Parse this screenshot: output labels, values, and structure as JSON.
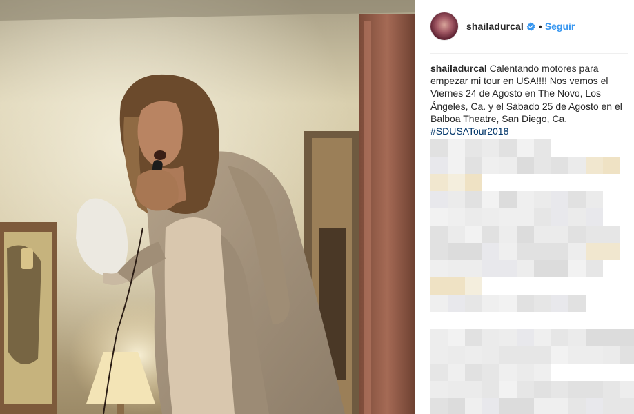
{
  "post": {
    "username": "shailadurcal",
    "separator": "•",
    "follow_label": "Seguir",
    "caption_text": "Calentando motores para empezar mi tour en USA!!!! Nos vemos el Viernes 24 de Agosto en The Novo, Los Ángeles, Ca. y el Sábado 25 de Agosto en el Balboa Theatre, San Diego, Ca.",
    "hashtag": "#SDUSATour2018"
  },
  "icons": {
    "verified": "verified-badge-icon",
    "avatar": "profile-avatar"
  },
  "colors": {
    "link_blue": "#3897f0",
    "hashtag_blue": "#003569",
    "text": "#262626",
    "divider": "#efefef"
  }
}
